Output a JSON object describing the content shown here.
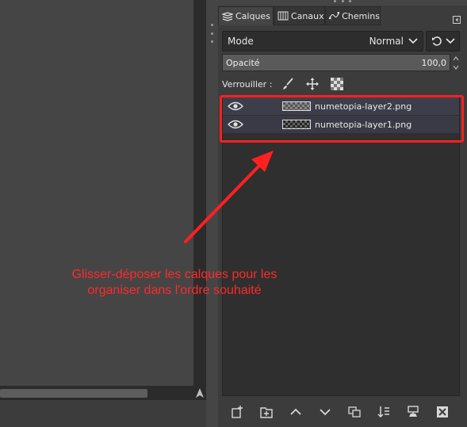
{
  "dock": {
    "tabs": [
      {
        "label": "Calques",
        "icon": "layers-icon"
      },
      {
        "label": "Canaux",
        "icon": "channels-icon"
      },
      {
        "label": "Chemins",
        "icon": "paths-icon"
      }
    ],
    "mode_label": "Mode",
    "mode_value": "Normal",
    "opacity_label": "Opacité",
    "opacity_value": "100,0",
    "lock_label": "Verrouiller :"
  },
  "layers": [
    {
      "name": "numetopia-layer2.png",
      "visible": true
    },
    {
      "name": "numetopia-layer1.png",
      "visible": true
    }
  ],
  "annotation": {
    "line1": "Glisser-déposer les calques pour les",
    "line2": "organiser dans l'ordre souhaité",
    "color": "#ff2a2a"
  },
  "bottom_toolbar": [
    "new-layer-icon",
    "new-layer-group-icon",
    "raise-layer-icon",
    "lower-layer-icon",
    "duplicate-layer-icon",
    "merge-down-icon",
    "anchor-layer-icon",
    "delete-layer-icon"
  ]
}
